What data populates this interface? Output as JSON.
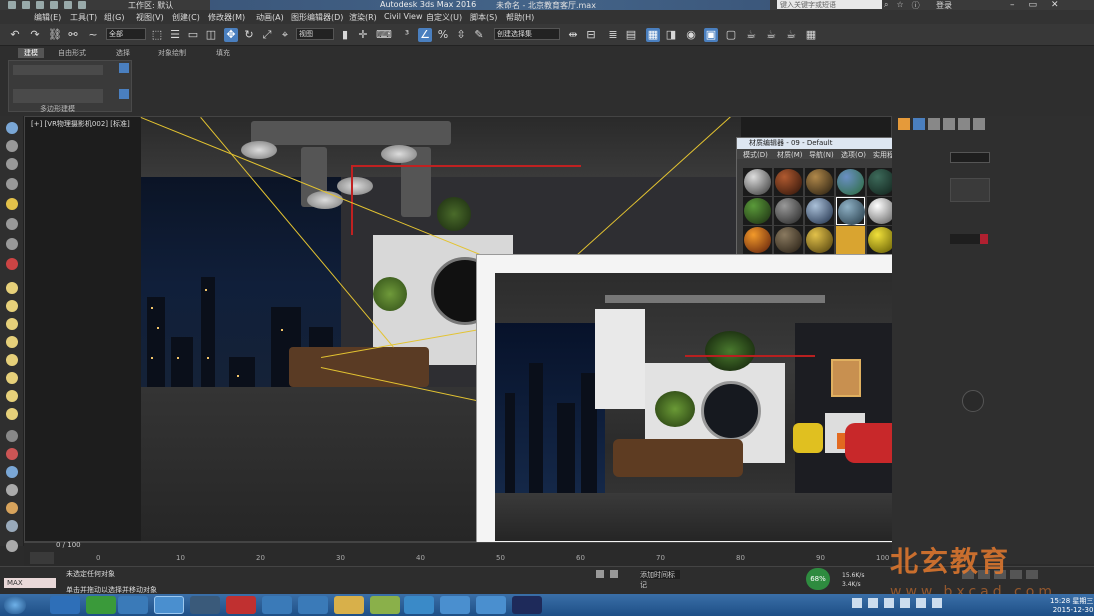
{
  "titlebar": {
    "workspace": "工作区: 默认",
    "app_title": "Autodesk 3ds Max 2016",
    "file_title": "未命名 - 北京教育客厅.max",
    "search_placeholder": "键入关键字或短语",
    "login": "登录"
  },
  "menu": [
    "编辑(E)",
    "工具(T)",
    "组(G)",
    "视图(V)",
    "创建(C)",
    "修改器(M)",
    "动画(A)",
    "图形编辑器(D)",
    "渲染(R)",
    "Civil View",
    "自定义(U)",
    "脚本(S)",
    "帮助(H)"
  ],
  "toolbar": {
    "filter_value": "全部",
    "view_value": "视图",
    "selection_set_placeholder": "创建选择集"
  },
  "ribbon": {
    "tabs": [
      "建模",
      "自由形式",
      "选择",
      "对象绘制",
      "填充"
    ],
    "panel_label": "多边形建模"
  },
  "viewport": {
    "label": "[+] [VR物理摄影机002] [标准]"
  },
  "material_editor": {
    "title": "材质编辑器 - 09 - Default",
    "menu": [
      "模式(D)",
      "材质(M)",
      "导航(N)",
      "选项(O)",
      "实用程序(U)"
    ]
  },
  "render_window": {
    "close_label": "×"
  },
  "timeline": {
    "frame_display": "0 / 100",
    "ticks": [
      "0",
      "10",
      "20",
      "30",
      "40",
      "50",
      "60",
      "70",
      "80",
      "90",
      "100"
    ]
  },
  "status": {
    "maxscript_label": "MAX",
    "selection": "未选定任何对象",
    "hint": "单击并拖动以选择并移动对象",
    "add_time_tag": "添加时间标记"
  },
  "perf": {
    "percent": "68%",
    "up": "15.6K/s",
    "down": "3.4K/s"
  },
  "watermark": {
    "brand": "北玄教育",
    "url": "www.bxcad.com"
  },
  "clock": {
    "time": "15:28 星期三",
    "date": "2015-12-30"
  },
  "colors": {
    "accent_blue": "#4a7fbf",
    "watermark_orange": "#e57a2e",
    "perf_green": "#2e8b3f"
  }
}
